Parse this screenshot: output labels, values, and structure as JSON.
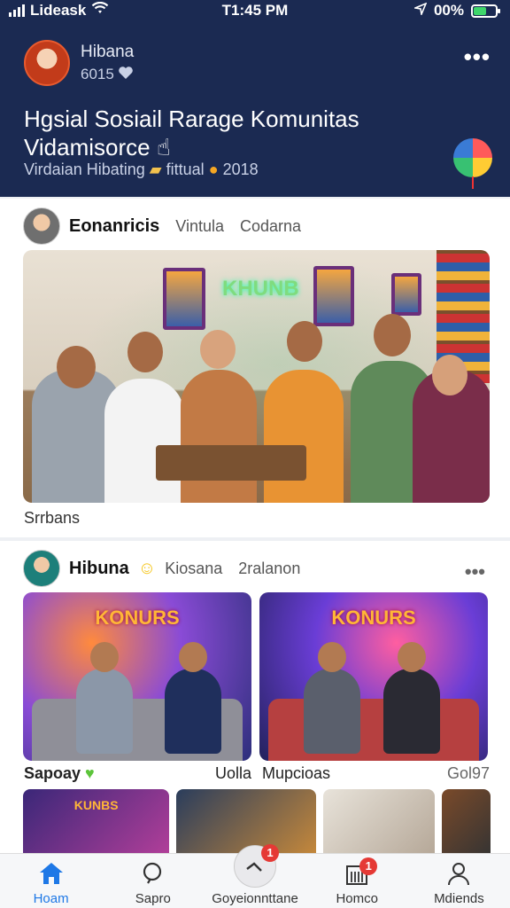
{
  "status_bar": {
    "carrier": "Lideask",
    "time": "T1:45 PM",
    "battery": "00%",
    "battery_level": 0.55
  },
  "profile": {
    "name": "Hibana",
    "sub": "6015"
  },
  "header": {
    "title": "Hgsial Sosiail Rarage Komunitas Vidamisorce",
    "subtitle_a": "Virdaian Hibating",
    "subtitle_b": "fittual",
    "year": "2018"
  },
  "post1": {
    "author": "Eonanricis",
    "meta_a": "Vintula",
    "meta_b": "Codarna",
    "sign": "KHUNB",
    "caption": "Srrbans"
  },
  "post2": {
    "author": "Hibuna",
    "meta_a": "Kiosana",
    "meta_b": "2ralanon",
    "tag_a": "KONURS",
    "tag_b": "KONURS",
    "row_label": "Sapoay",
    "row_a": "Uolla",
    "row_b": "Mupcioas",
    "row_c": "Gol97",
    "thumb_tag": "KUNBS"
  },
  "tabbar": {
    "tabs": [
      {
        "label": "Hoam",
        "icon": "home-icon"
      },
      {
        "label": "Sapro",
        "icon": "search-icon"
      },
      {
        "label": "Goyeionnttane",
        "icon": "share-icon",
        "badge": "1"
      },
      {
        "label": "Homco",
        "icon": "building-icon",
        "badge": "1"
      },
      {
        "label": "Mdiends",
        "icon": "person-icon"
      }
    ]
  },
  "colors": {
    "header_bg": "#1b2a52",
    "active_tab": "#1e78e6",
    "badge": "#e53935"
  }
}
